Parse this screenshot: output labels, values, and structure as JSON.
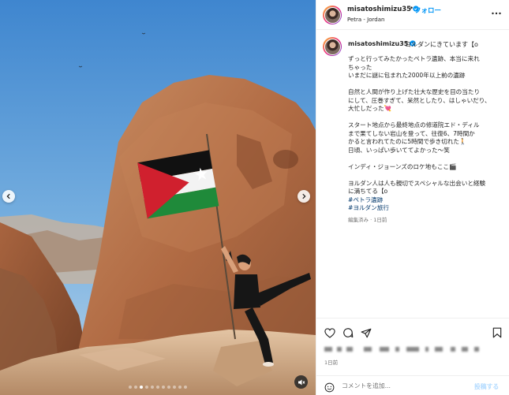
{
  "post": {
    "username": "misatoshimizu35",
    "location": "Petra - Jordan",
    "header_separator": "•",
    "follow_label": "フォロー",
    "more_icon": "more-horizontal-icon",
    "caption_first_line": "ヨルダンにきています【o",
    "caption_lines": [
      "ずっと行ってみたかったペトラ遺跡、本当に来れ",
      "ちゃった",
      "いまだに謎に包まれた2000年以上前の遺跡",
      "",
      "自然と人間が作り上げた壮大な歴史を目の当たり",
      "にして、圧巻すぎて、呆然としたり、はしゃいだり、",
      "大忙しだった💘",
      "",
      "スタート地点から最終地点の修道院エド・ディル",
      "まで果てしない岩山を登って、往復6、7時間か",
      "かると言われてたのに5時間で歩き切れた🚶",
      "日頃、いっぱい歩いててよかった〜笑",
      "",
      "インディ・ジョーンズのロケ地もここ🎬",
      "",
      "ヨルダン人は人も親切でスペシャルな出会いと経験",
      "に満ちてる【o"
    ],
    "hashtags": [
      "#ペトラ遺跡",
      "#ヨルダン旅行"
    ],
    "caption_meta": "編集済み · 1日前",
    "timestamp": "1日前",
    "comment_placeholder": "コメントを追加...",
    "post_label": "投稿する"
  },
  "media": {
    "total_slides": 11,
    "active_slide": 2,
    "colors": {
      "sky": "#5f9fd8",
      "rock": "#b9714a",
      "flag_black": "#111111",
      "flag_white": "#f3f3f3",
      "flag_green": "#1f8a3a",
      "flag_red": "#d0202e"
    }
  },
  "icons": {
    "like": "heart-icon",
    "comment": "comment-icon",
    "share": "send-icon",
    "save": "bookmark-icon",
    "emoji": "emoji-icon",
    "prev": "chevron-left-icon",
    "next": "chevron-right-icon",
    "mute": "speaker-muted-icon",
    "verified": "verified-badge-icon"
  },
  "theme": {
    "accent": "#0095f6",
    "text": "#262626",
    "muted": "#737373",
    "hashtag": "#00376b"
  }
}
